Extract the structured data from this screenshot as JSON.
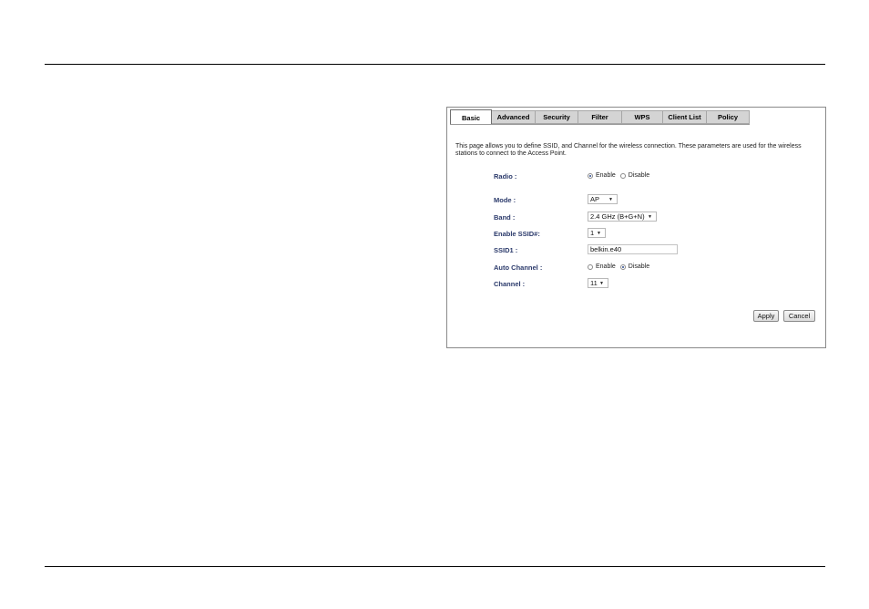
{
  "tabs": [
    {
      "label": "Basic",
      "active": true
    },
    {
      "label": "Advanced",
      "active": false
    },
    {
      "label": "Security",
      "active": false
    },
    {
      "label": "Filter",
      "active": false
    },
    {
      "label": "WPS",
      "active": false
    },
    {
      "label": "Client List",
      "active": false
    },
    {
      "label": "Policy",
      "active": false
    }
  ],
  "description": "This page allows you to define SSID, and Channel for the wireless connection. These parameters are used for the wireless stations to connect to the Access Point.",
  "form": {
    "radio": {
      "label": "Radio :",
      "enable": "Enable",
      "disable": "Disable",
      "selected": "enable"
    },
    "mode": {
      "label": "Mode :",
      "value": "AP"
    },
    "band": {
      "label": "Band :",
      "value": "2.4 GHz (B+G+N)"
    },
    "enable_ssid": {
      "label": "Enable SSID#:",
      "value": "1"
    },
    "ssid1": {
      "label": "SSID1 :",
      "value": "belkin.e40"
    },
    "auto_channel": {
      "label": "Auto Channel :",
      "enable": "Enable",
      "disable": "Disable",
      "selected": "disable"
    },
    "channel": {
      "label": "Channel :",
      "value": "11"
    }
  },
  "buttons": {
    "apply": "Apply",
    "cancel": "Cancel"
  },
  "colors": {
    "label": "#2b3a6b",
    "tab_bg": "#d4d4d4",
    "radio_dot": "#2c4a8f"
  }
}
